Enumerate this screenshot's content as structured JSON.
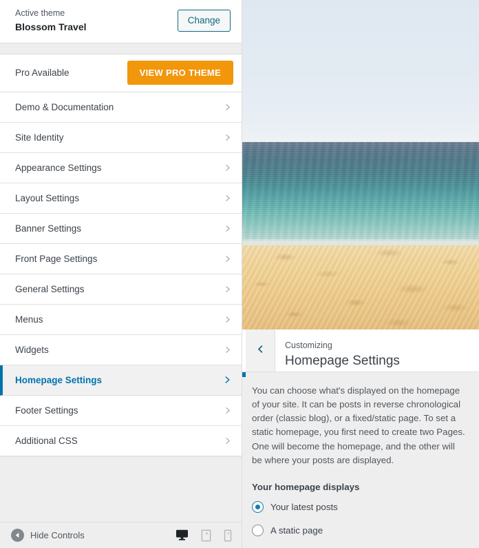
{
  "sidebar": {
    "theme": {
      "active_label": "Active theme",
      "name": "Blossom Travel",
      "change_button": "Change"
    },
    "pro": {
      "label": "Pro Available",
      "button": "VIEW PRO THEME"
    },
    "sections": [
      {
        "label": "Demo & Documentation",
        "active": false
      },
      {
        "label": "Site Identity",
        "active": false
      },
      {
        "label": "Appearance Settings",
        "active": false
      },
      {
        "label": "Layout Settings",
        "active": false
      },
      {
        "label": "Banner Settings",
        "active": false
      },
      {
        "label": "Front Page Settings",
        "active": false
      },
      {
        "label": "General Settings",
        "active": false
      },
      {
        "label": "Menus",
        "active": false
      },
      {
        "label": "Widgets",
        "active": false
      },
      {
        "label": "Homepage Settings",
        "active": true
      },
      {
        "label": "Footer Settings",
        "active": false
      },
      {
        "label": "Additional CSS",
        "active": false
      }
    ],
    "footer": {
      "hide_controls": "Hide Controls",
      "devices": [
        {
          "name": "desktop",
          "active": true
        },
        {
          "name": "tablet",
          "active": false
        },
        {
          "name": "mobile",
          "active": false
        }
      ]
    }
  },
  "panel": {
    "kicker": "Customizing",
    "title": "Homepage Settings",
    "description": "You can choose what's displayed on the homepage of your site. It can be posts in reverse chronological order (classic blog), or a fixed/static page. To set a static homepage, you first need to create two Pages. One will become the homepage, and the other will be where your posts are displayed.",
    "field_label": "Your homepage displays",
    "options": [
      {
        "label": "Your latest posts",
        "selected": true
      },
      {
        "label": "A static page",
        "selected": false
      }
    ]
  },
  "colors": {
    "accent_blue": "#0073aa",
    "pro_orange": "#f2960c",
    "panel_bg": "#eeeeee",
    "row_bg": "#ffffff"
  }
}
